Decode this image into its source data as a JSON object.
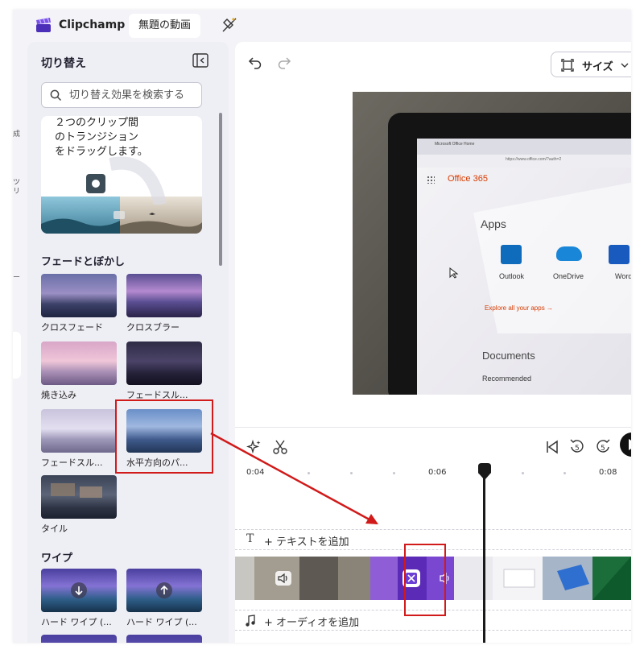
{
  "app": {
    "brand": "Clipchamp",
    "project_title": "無題の動画"
  },
  "rail": {
    "items": [
      "成",
      "ツ\nリ",
      "ー"
    ]
  },
  "panel": {
    "title": "切り替え",
    "search_placeholder": "切り替え効果を検索する",
    "tip_text": "２つのクリップ間\nのトランジション\nをドラッグします。",
    "sections": [
      {
        "title": "フェードとぼかし",
        "items": [
          "クロスフェード",
          "クロスブラー",
          "焼き込み",
          "フェードスル...",
          "フェードスル...",
          "水平方向のパ...",
          "タイル"
        ]
      },
      {
        "title": "ワイプ",
        "items": [
          "ハード ワイプ (...",
          "ハード ワイプ (..."
        ]
      }
    ]
  },
  "preview": {
    "size_label": "サイズ",
    "video_screen": {
      "tab_title": "Microsoft Office Home",
      "url": "https://www.office.com/?auth=2",
      "product": "Office 365",
      "apps_heading": "Apps",
      "apps": [
        "Outlook",
        "OneDrive",
        "Word"
      ],
      "explore_link": "Explore all your apps →",
      "documents_heading": "Documents",
      "recommended": "Recommended"
    }
  },
  "timeline": {
    "time_labels": [
      "0:04",
      "0:06",
      "0:08"
    ],
    "add_text": "+ テキストを追加",
    "add_audio": "+ オーディオを追加",
    "skip_back_seconds": "5",
    "skip_forward_seconds": "5"
  },
  "colors": {
    "accent": "#7b52e8",
    "annotation_red": "#d11a1a",
    "office_orange": "#d83b01"
  }
}
